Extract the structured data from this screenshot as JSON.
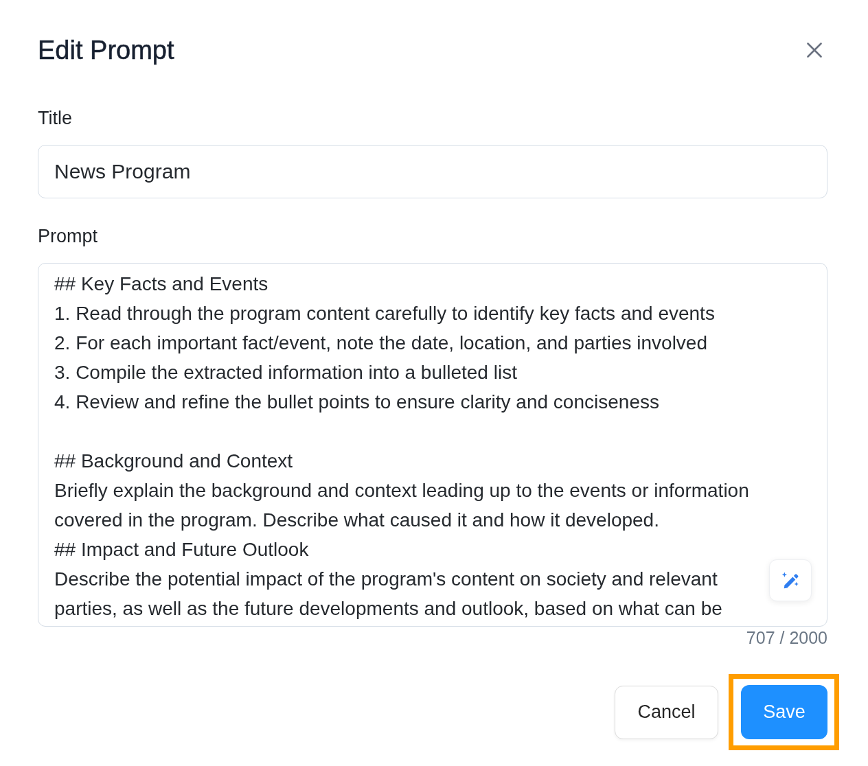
{
  "dialog": {
    "title": "Edit Prompt"
  },
  "fields": [
    {
      "kind": "input",
      "label": "Title",
      "value": "News Program"
    },
    {
      "kind": "textarea",
      "label": "Prompt",
      "value": "## Key Facts and Events\n1. Read through the program content carefully to identify key facts and events\n2. For each important fact/event, note the date, location, and parties involved\n3. Compile the extracted information into a bulleted list\n4. Review and refine the bullet points to ensure clarity and conciseness\n\n## Background and Context\nBriefly explain the background and context leading up to the events or information\ncovered in the program. Describe what caused it and how it developed.\n## Impact and Future Outlook\nDescribe the potential impact of the program's content on society and relevant\nparties, as well as the future developments and outlook, based on what can be",
      "counter": "707 / 2000"
    }
  ],
  "buttons": [
    {
      "label": "Cancel",
      "kind": "secondary",
      "highlighted": false
    },
    {
      "label": "Save",
      "kind": "primary",
      "highlighted": true
    }
  ]
}
